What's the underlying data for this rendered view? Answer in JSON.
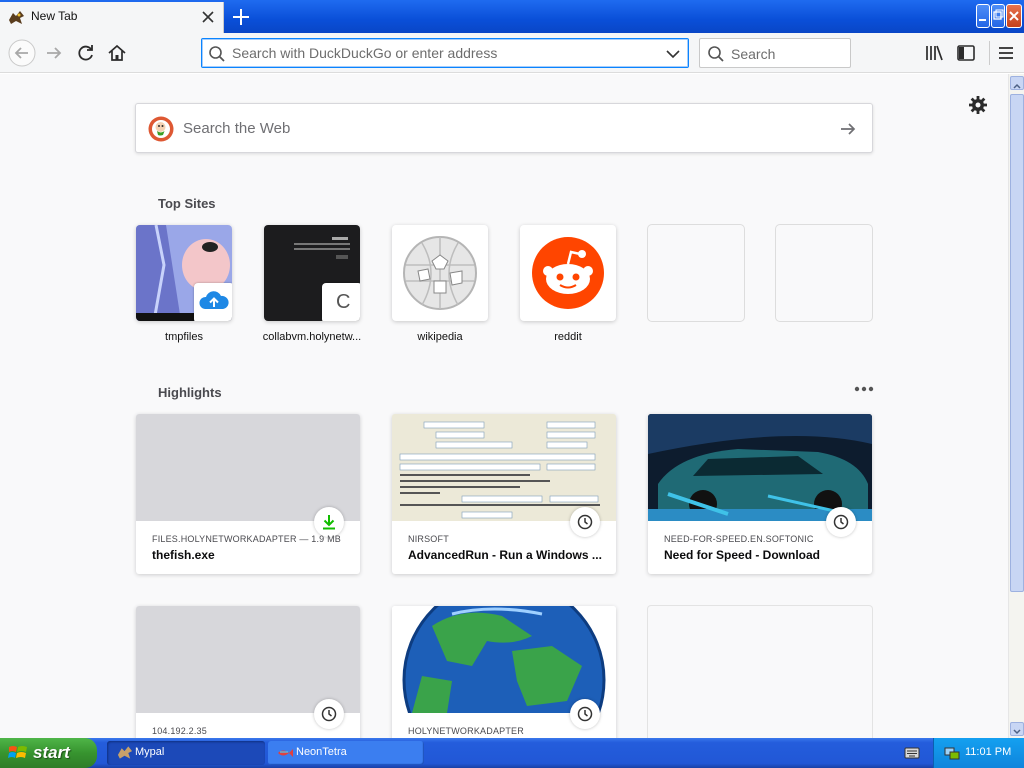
{
  "browser": {
    "tab": {
      "title": "New Tab"
    },
    "urlbar": {
      "placeholder": "Search with DuckDuckGo or enter address"
    },
    "searchbar": {
      "placeholder": "Search"
    }
  },
  "newtab": {
    "web_search": {
      "placeholder": "Search the Web"
    },
    "top_sites": {
      "title": "Top Sites",
      "sites": [
        {
          "label": "tmpfiles"
        },
        {
          "label": "collabvm.holynetw..."
        },
        {
          "label": "wikipedia"
        },
        {
          "label": "reddit"
        },
        {
          "label": ""
        },
        {
          "label": ""
        }
      ],
      "collab_badge_letter": "C"
    },
    "highlights": {
      "title": "Highlights",
      "cards": [
        {
          "host": "FILES.HOLYNETWORKADAPTER — 1.9 MB",
          "title": "thefish.exe",
          "icon": "download-icon"
        },
        {
          "host": "NIRSOFT",
          "title": "AdvancedRun - Run a Windows ...",
          "icon": "clock-icon"
        },
        {
          "host": "NEED-FOR-SPEED.EN.SOFTONIC",
          "title": "Need for Speed - Download",
          "icon": "clock-icon"
        },
        {
          "host": "104.192.2.35",
          "title": "",
          "icon": "clock-icon"
        },
        {
          "host": "HOLYNETWORKADAPTER",
          "title": "",
          "icon": "clock-icon"
        }
      ]
    }
  },
  "taskbar": {
    "start_label": "start",
    "tasks": [
      {
        "label": "Mypal"
      },
      {
        "label": "NeonTetra"
      }
    ],
    "clock": "11:01 PM"
  },
  "colors": {
    "accent": "#0a84ff",
    "reddit": "#ff4500",
    "download_green": "#12bc00",
    "xp_blue": "#245ddc",
    "xp_start_green": "#37942f"
  }
}
